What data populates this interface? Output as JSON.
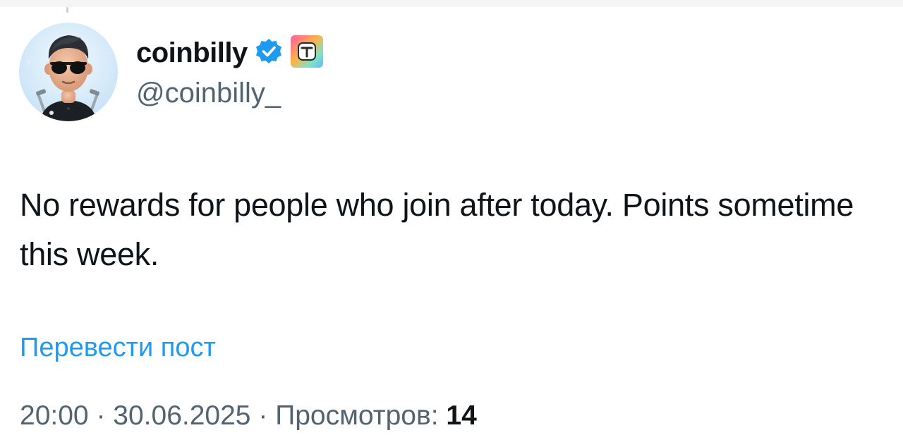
{
  "author": {
    "display_name": "coinbilly",
    "handle": "@coinbilly_",
    "verified_icon": "verified-checkmark-icon",
    "badge_icon": "tonkeeper-t-badge-icon"
  },
  "tweet": {
    "text": "No rewards for people who join after today. Points sometime this week.",
    "translate_label": "Перевести пост"
  },
  "meta": {
    "time": "20:00",
    "separator": "·",
    "date": "30.06.2025",
    "views_label": "Просмотров:",
    "views_count": "14"
  },
  "colors": {
    "link": "#1d9bf0",
    "verified": "#1d9bf0",
    "secondary_text": "#536471",
    "primary_text": "#0f1419"
  }
}
